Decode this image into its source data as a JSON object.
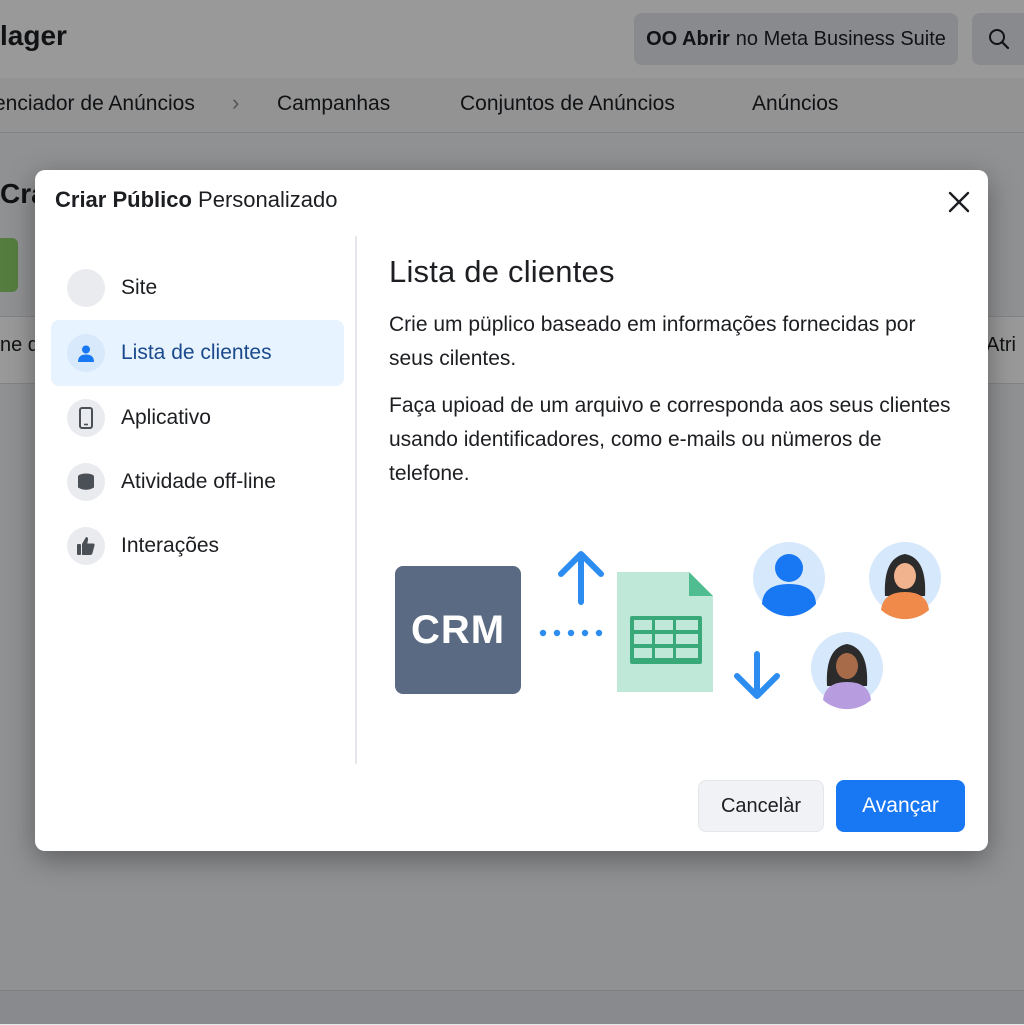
{
  "app": {
    "title_fragment": "lager",
    "meta_button": {
      "logo": "OO Abrir",
      "label": " no Meta Business Suite"
    },
    "nav": [
      "enciador de Anúncios",
      "›",
      "Campanhas",
      "Conjuntos de Anúncios",
      "Anúncios"
    ],
    "bg_heading_fragment": "Cra",
    "bg_left_fragment": "ne d",
    "bg_right_fragment": "Atri"
  },
  "modal": {
    "title_bold": "Criar Público",
    "title_rest": " Personalizado",
    "sidebar": [
      {
        "label": "Site",
        "icon": "blank-circle-icon",
        "active": false
      },
      {
        "label": "Lista de clientes",
        "icon": "person-icon",
        "active": true
      },
      {
        "label": "Aplicativo",
        "icon": "phone-icon",
        "active": false
      },
      {
        "label": "Atividade off-line",
        "icon": "database-icon",
        "active": false
      },
      {
        "label": "Interações",
        "icon": "thumbs-up-icon",
        "active": false
      }
    ],
    "content": {
      "heading": "Lista de clientes",
      "paragraph1": "Crie um püplico baseado em informações fornecidas por seus cilentes.",
      "paragraph2": "Faça upioad de um arquivo e corresponda aos seus clientes usando identificadores, como e-mails ou nümeros de telefone.",
      "crm_label": "CRM"
    },
    "buttons": {
      "cancel": "Cancelàr",
      "next": "Avançar"
    },
    "colors": {
      "primary": "#1877f2",
      "active_bg": "#e7f3ff",
      "crm": "#5a6a82",
      "sheet": "#bfe8d8",
      "arrow": "#2d8cf0"
    }
  }
}
